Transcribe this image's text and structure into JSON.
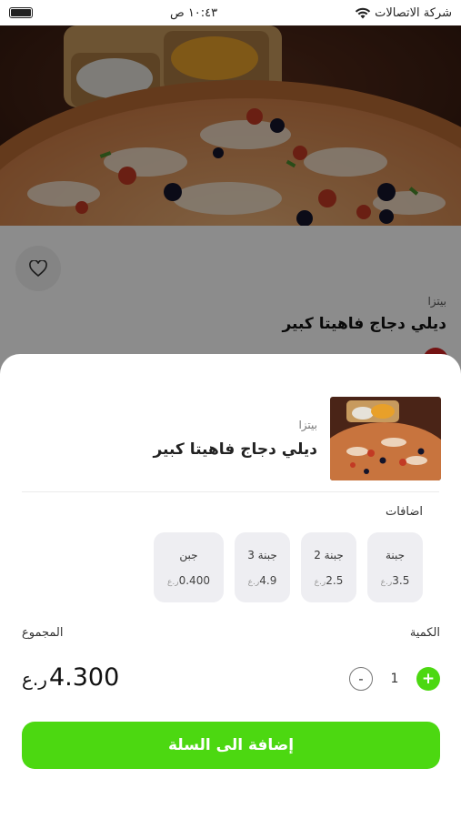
{
  "status_bar": {
    "carrier": "شركة الاتصالات",
    "time": "١٠:٤٣ ص"
  },
  "product": {
    "category": "بيتزا",
    "name": "ديلي دجاج فاهيتا كبير"
  },
  "sheet": {
    "category": "بيتزا",
    "name": "ديلي دجاج فاهيتا كبير",
    "addons_title": "اضافات",
    "addons": [
      {
        "name": "جبنة",
        "price": "3.5",
        "currency": "ر.ع"
      },
      {
        "name": "جبنة 2",
        "price": "2.5",
        "currency": "ر.ع"
      },
      {
        "name": "جبنة 3",
        "price": "4.9",
        "currency": "ر.ع"
      },
      {
        "name": "جبن",
        "price": "0.400",
        "currency": "ر.ع"
      }
    ],
    "quantity_label": "الكمية",
    "quantity": "1",
    "plus": "+",
    "minus": "-",
    "total_label": "المجموع",
    "total_value": "4.300",
    "total_currency": "ر.ع",
    "add_to_cart": "إضافة الى السلة"
  },
  "colors": {
    "accent_green": "#4cd811",
    "badge_red": "#d32323"
  },
  "icons": {
    "battery": "battery-icon",
    "wifi": "wifi-icon",
    "favorite": "heart-icon"
  }
}
